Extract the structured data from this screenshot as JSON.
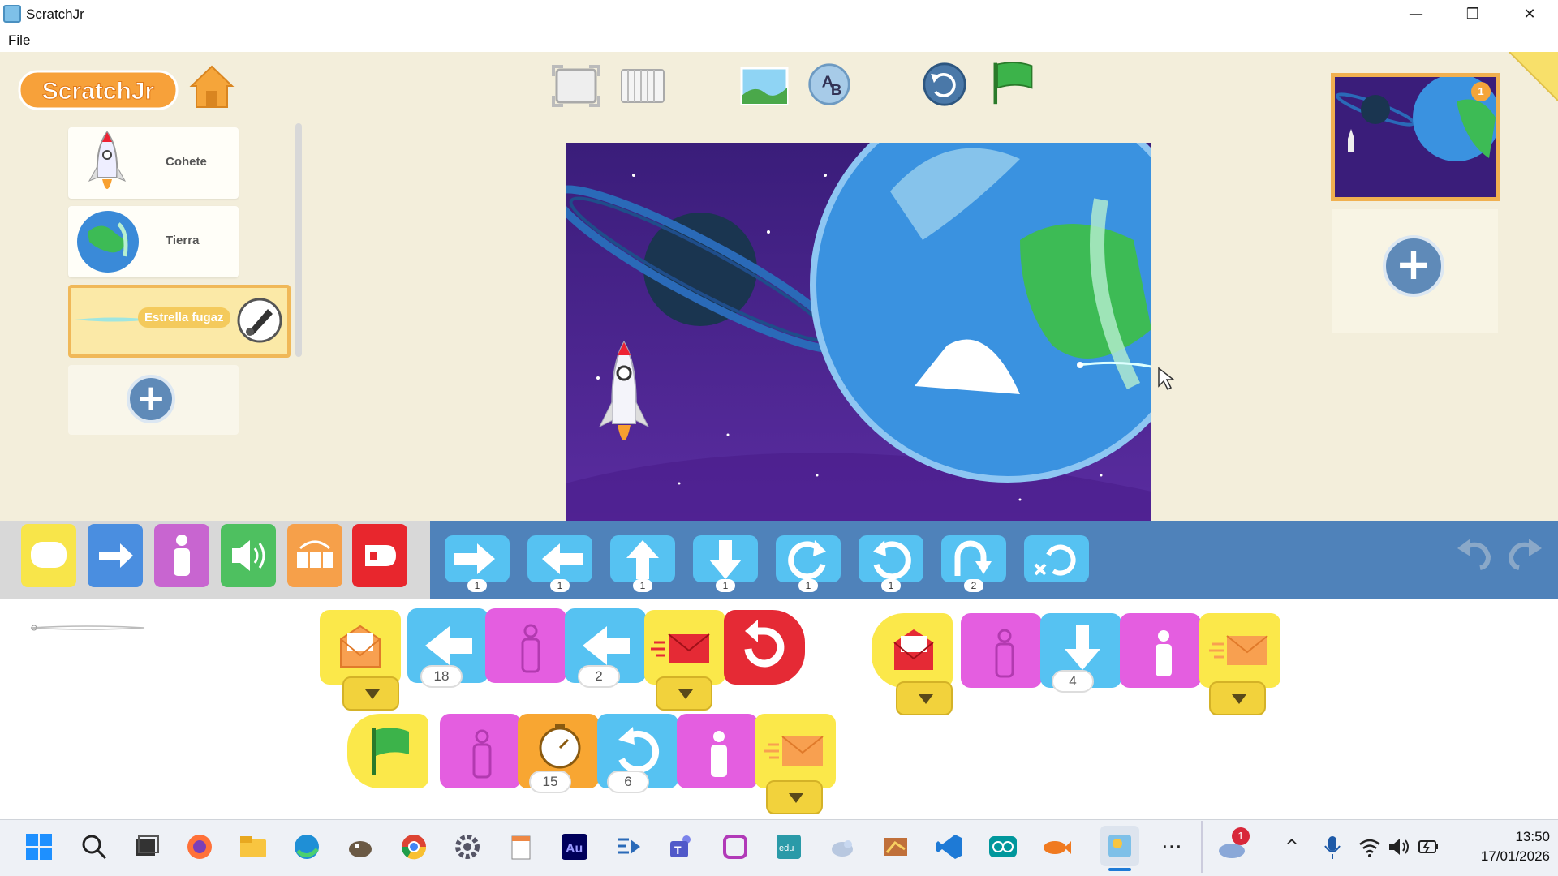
{
  "window": {
    "title": "ScratchJr",
    "icon": "scratchjr-app-icon",
    "minimize": "—",
    "restore": "❒",
    "close": "✕"
  },
  "menu": {
    "file": "File"
  },
  "header": {
    "logo": "ScratchJr",
    "home_icon": "home-icon",
    "tools": [
      "fullscreen-icon",
      "grid-icon",
      "background-icon",
      "text-icon",
      "reset-icon",
      "green-flag-icon"
    ]
  },
  "sprites": [
    {
      "name": "Cohete",
      "icon": "rocket-icon"
    },
    {
      "name": "Tierra",
      "icon": "earth-icon"
    },
    {
      "name": "Estrella fugaz",
      "icon": "shooting-star-icon",
      "selected": true
    }
  ],
  "pages": {
    "badge": "1",
    "add_icon": "plus-icon"
  },
  "categories": [
    {
      "id": "triggering",
      "color": "#f8e54a",
      "icon": "trigger-icon"
    },
    {
      "id": "motion",
      "color": "#4a8ee0",
      "icon": "motion-arrow-icon"
    },
    {
      "id": "looks",
      "color": "#c865d0",
      "icon": "person-icon"
    },
    {
      "id": "sound",
      "color": "#4ec060",
      "icon": "speaker-icon"
    },
    {
      "id": "control",
      "color": "#f6a04a",
      "icon": "control-icon"
    },
    {
      "id": "end",
      "color": "#e8262d",
      "icon": "end-icon"
    }
  ],
  "palette": [
    {
      "icon": "move-right-icon",
      "num": "1"
    },
    {
      "icon": "move-left-icon",
      "num": "1"
    },
    {
      "icon": "move-up-icon",
      "num": "1"
    },
    {
      "icon": "move-down-icon",
      "num": "1"
    },
    {
      "icon": "turn-right-icon",
      "num": "1"
    },
    {
      "icon": "turn-left-icon",
      "num": "1"
    },
    {
      "icon": "hop-icon",
      "num": "2"
    },
    {
      "icon": "go-home-icon",
      "num": ""
    }
  ],
  "scripts": {
    "row1_nums": [
      "18",
      "2"
    ],
    "row2_nums": [
      "15",
      "6"
    ],
    "row3_nums": [
      "4"
    ]
  },
  "taskbar": {
    "icons": [
      "start-icon",
      "search-icon",
      "task-view-icon",
      "firefox-icon",
      "file-explorer-icon",
      "edge-icon",
      "gimp-icon",
      "chrome-icon",
      "settings-icon",
      "notepad-icon",
      "audition-icon",
      "media-icon",
      "teams-icon",
      "app-icon",
      "edu-icon",
      "bird-icon",
      "drawing-icon",
      "vscode-icon",
      "arduino-icon",
      "fish-icon",
      "scratchjr-icon",
      "more-icon"
    ],
    "weather_badge": "1",
    "time": "13:50",
    "date": "17/01/2026"
  }
}
